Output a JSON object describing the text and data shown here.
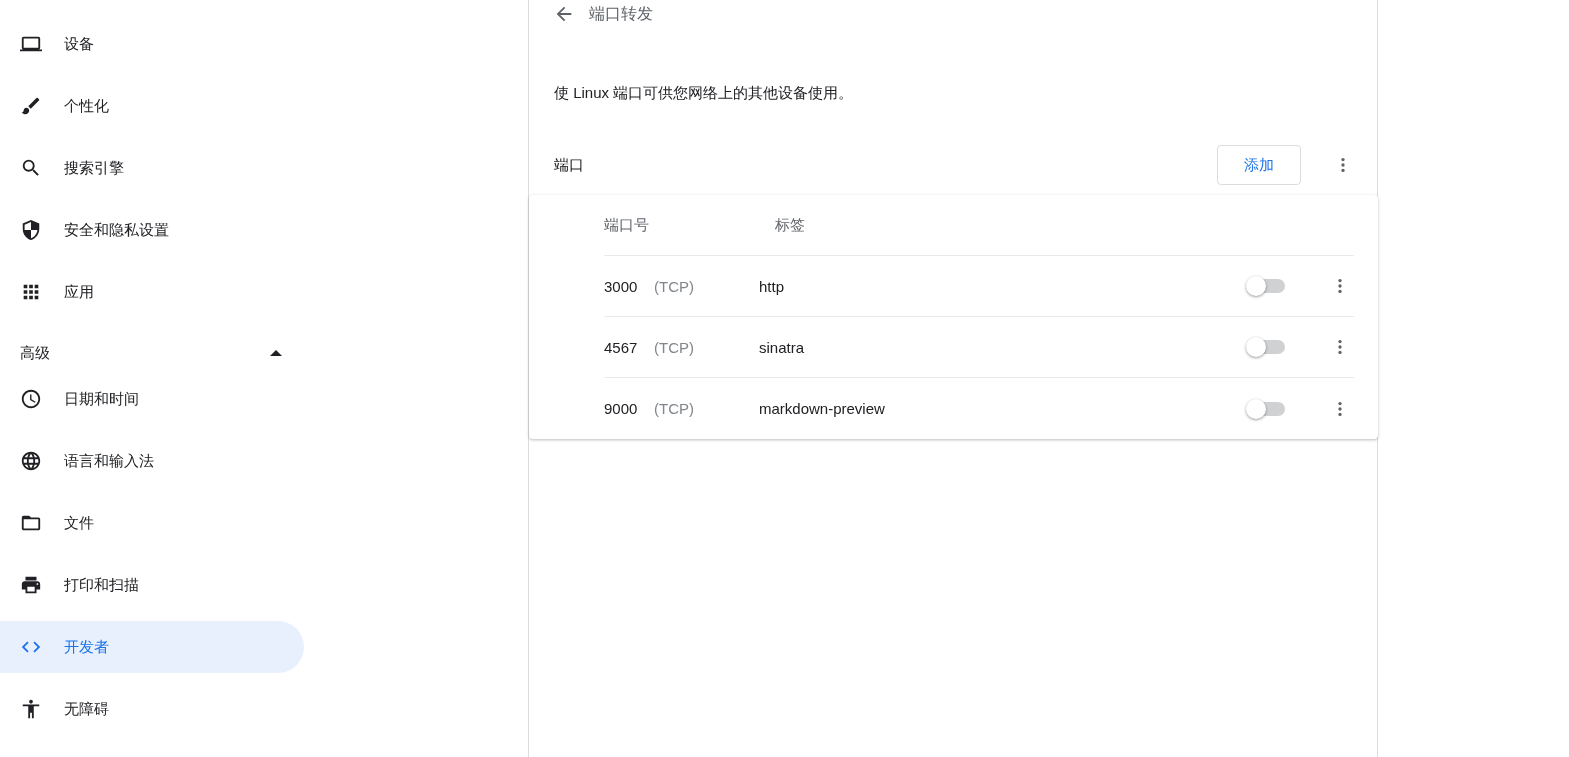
{
  "sidebar": {
    "items": [
      {
        "label": "设备",
        "selected": false
      },
      {
        "label": "个性化",
        "selected": false
      },
      {
        "label": "搜索引擎",
        "selected": false
      },
      {
        "label": "安全和隐私设置",
        "selected": false
      },
      {
        "label": "应用",
        "selected": false
      }
    ],
    "advanced": {
      "label": "高级",
      "expanded": true,
      "items": [
        {
          "label": "日期和时间",
          "selected": false
        },
        {
          "label": "语言和输入法",
          "selected": false
        },
        {
          "label": "文件",
          "selected": false
        },
        {
          "label": "打印和扫描",
          "selected": false
        },
        {
          "label": "开发者",
          "selected": true
        },
        {
          "label": "无障碍",
          "selected": false
        }
      ]
    }
  },
  "page": {
    "title": "端口转发",
    "description": "使 Linux 端口可供您网络上的其他设备使用。",
    "ports_label": "端口",
    "add_button": "添加"
  },
  "table": {
    "columns": [
      "端口号",
      "标签"
    ],
    "rows": [
      {
        "port": "3000",
        "protocol": "(TCP)",
        "label": "http",
        "on": false
      },
      {
        "port": "4567",
        "protocol": "(TCP)",
        "label": "sinatra",
        "on": false
      },
      {
        "port": "9000",
        "protocol": "(TCP)",
        "label": "markdown-preview",
        "on": false
      }
    ]
  }
}
